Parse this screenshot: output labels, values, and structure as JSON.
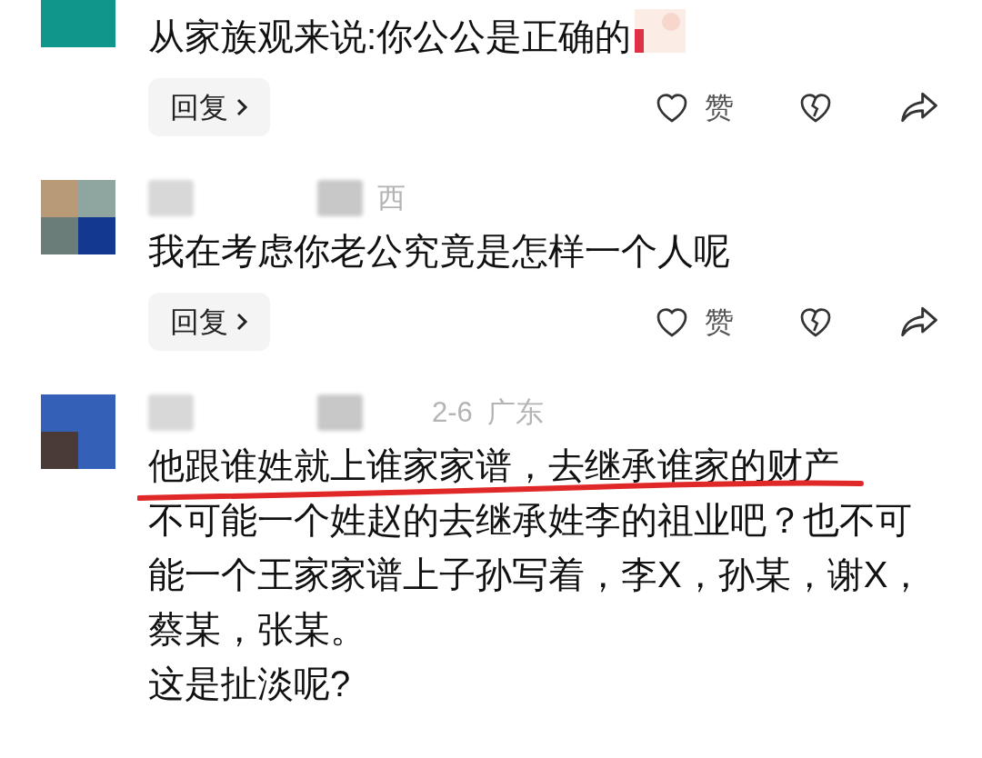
{
  "comments": [
    {
      "avatar": {
        "kind": "picture"
      },
      "paragraphs": [
        {
          "text": "从家族观来说:你公公是正确的",
          "underlined": false
        }
      ],
      "sticker": {
        "kind": "picture"
      },
      "actions": {
        "reply": "回复",
        "like": "赞"
      }
    },
    {
      "avatar": {
        "kind": "picture"
      },
      "meta": {
        "blurred": true,
        "location": "西"
      },
      "paragraphs": [
        {
          "text": "我在考虑你老公究竟是怎样一个人呢",
          "underlined": false
        }
      ],
      "actions": {
        "reply": "回复",
        "like": "赞"
      }
    },
    {
      "avatar": {
        "kind": "picture"
      },
      "meta": {
        "blurred": true,
        "date": "2-6",
        "location": "广东"
      },
      "paragraphs": [
        {
          "text": "他跟谁姓就上谁家家谱，去继承谁家的财产",
          "underlined": true
        },
        {
          "text": "不可能一个姓赵的去继承姓李的祖业吧？也不可能一个王家家谱上子孙写着，李X，孙某，谢X，蔡某，张某。",
          "underlined": false
        },
        {
          "text": "这是扯淡呢?",
          "underlined": false
        }
      ]
    }
  ]
}
